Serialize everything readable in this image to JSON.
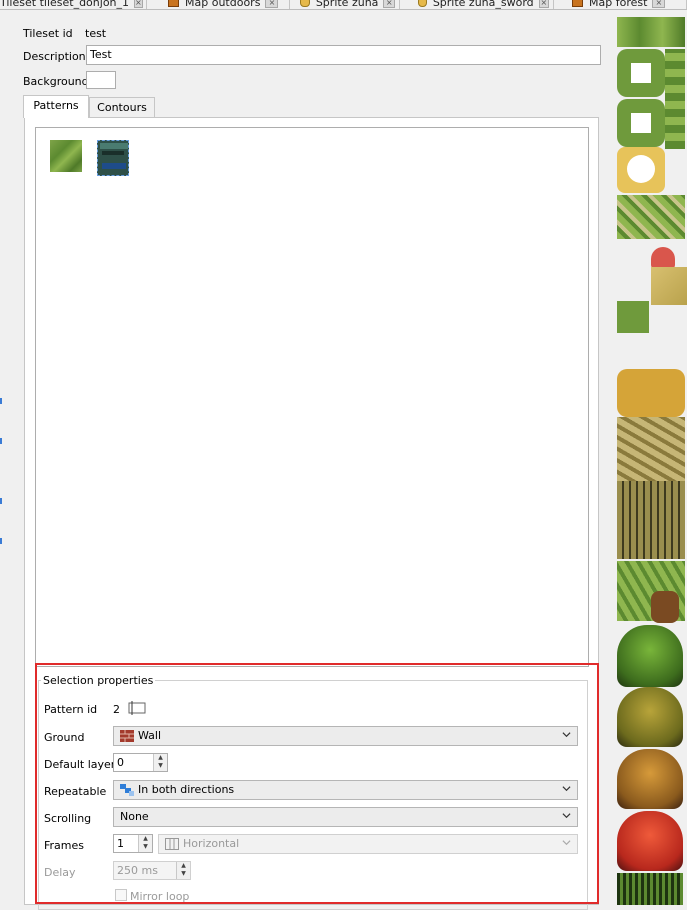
{
  "tabs": [
    {
      "label": "Tileset tileset_donjon_1",
      "icon": "none"
    },
    {
      "label": "Map outdoors",
      "icon": "map-icon"
    },
    {
      "label": "Sprite zuna",
      "icon": "sprite-icon"
    },
    {
      "label": "Sprite zuna_sword",
      "icon": "sprite-icon"
    },
    {
      "label": "Map forest",
      "icon": "map-icon"
    }
  ],
  "tab_close_glyph": "×",
  "tileset": {
    "id_label": "Tileset id",
    "id_value": "test",
    "description_label": "Description",
    "description_value": "Test",
    "background_label": "Background",
    "background_color": "#ffffff"
  },
  "subtabs": {
    "patterns": "Patterns",
    "contours": "Contours"
  },
  "selection": {
    "title": "Selection properties",
    "pattern_id_label": "Pattern id",
    "pattern_id_value": "2",
    "ground_label": "Ground",
    "ground_value": "Wall",
    "default_layer_label": "Default layer",
    "default_layer_value": "0",
    "repeatable_label": "Repeatable",
    "repeatable_value": "In both directions",
    "scrolling_label": "Scrolling",
    "scrolling_value": "None",
    "frames_label": "Frames",
    "frames_value": "1",
    "frames_direction": "Horizontal",
    "delay_label": "Delay",
    "delay_value": "250 ms",
    "mirror_loop_label": "Mirror loop"
  },
  "colors": {
    "highlight": "#e02b2b",
    "accent": "#3a7bd5"
  }
}
